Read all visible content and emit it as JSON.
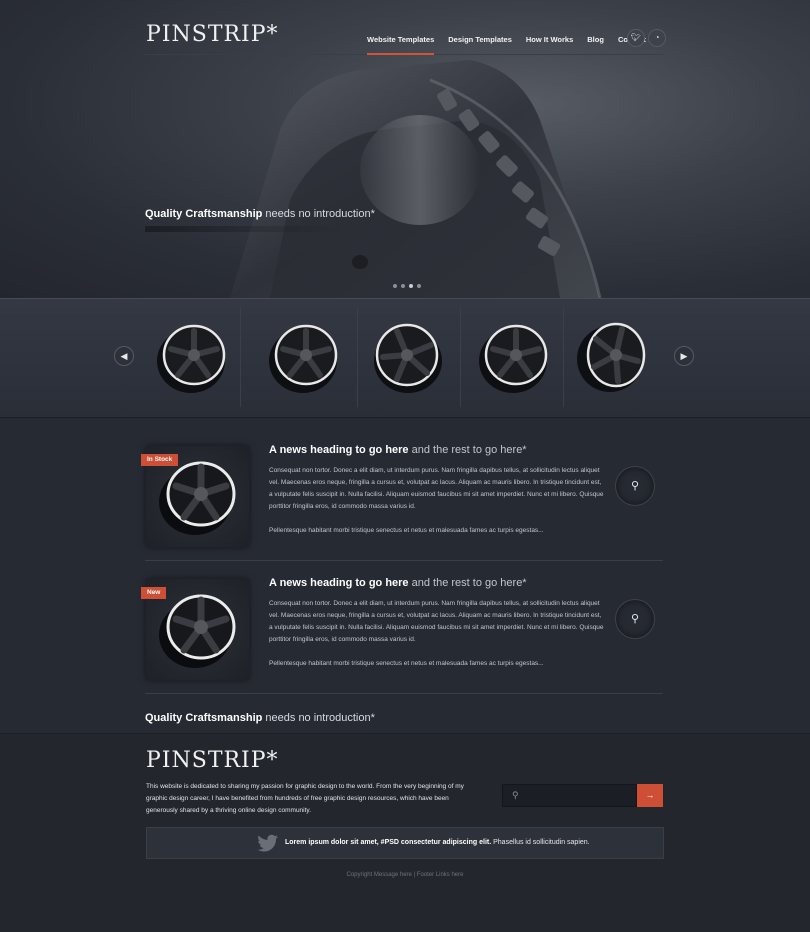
{
  "brand": {
    "logo": "PINSTRIP*"
  },
  "nav": {
    "items": [
      {
        "label": "Website Templates",
        "active": true
      },
      {
        "label": "Design Templates",
        "active": false
      },
      {
        "label": "How It Works",
        "active": false
      },
      {
        "label": "Blog",
        "active": false
      },
      {
        "label": "Contact",
        "active": false
      }
    ]
  },
  "social": {
    "twitter_icon": "twitter-icon",
    "rss_icon": "rss-icon"
  },
  "hero": {
    "tagline_bold": "Quality Craftsmanship",
    "tagline_rest": " needs no introduction*",
    "slides": 4,
    "active_slide": 2
  },
  "carousel": {
    "prev_icon": "chevron-left-icon",
    "next_icon": "chevron-right-icon",
    "items": 5
  },
  "news": [
    {
      "badge": "In Stock",
      "heading_bold": "A news heading to go here",
      "heading_rest": " and the rest to go here*",
      "body": "Consequat non tortor. Donec a elit diam, ut interdum purus. Nam fringilla dapibus tellus, at sollicitudin lectus aliquet vel. Maecenas eros neque, fringilla a cursus et, volutpat ac lacus. Aliquam ac mauris libero. In tristique tincidunt est, a vulputate felis suscipit in. Nulla facilisi. Aliquam euismod faucibus mi sit amet imperdiet. Nunc et mi libero. Quisque porttitor fringilla eros, id commodo massa varius id.",
      "body2": "Pellentesque habitant morbi tristique senectus et netus et malesuada fames ac turpis egestas..."
    },
    {
      "badge": "New",
      "heading_bold": "A news heading to go here",
      "heading_rest": " and the rest to go here*",
      "body": "Consequat non tortor. Donec a elit diam, ut interdum purus. Nam fringilla dapibus tellus, at sollicitudin lectus aliquet vel. Maecenas eros neque, fringilla a cursus et, volutpat ac lacus. Aliquam ac mauris libero. In tristique tincidunt est, a vulputate felis suscipit in. Nulla facilisi. Aliquam euismod faucibus mi sit amet imperdiet. Nunc et mi libero. Quisque porttitor fringilla eros, id commodo massa varius id.",
      "body2": "Pellentesque habitant morbi tristique senectus et netus et malesuada fames ac turpis egestas..."
    }
  ],
  "quote": {
    "bold": "Quality Craftsmanship",
    "rest": " needs no introduction*"
  },
  "footer": {
    "logo": "PINSTRIP*",
    "about": "This website is dedicated to sharing my passion for graphic design to the world. From the very beginning of my graphic design career, I have benefited from hundreds of free graphic design resources, which have been generously shared by a thriving online design community.",
    "search_placeholder": "",
    "search_button": "→",
    "tweet_bold": "Lorem ipsum dolor sit amet, #PSD consectetur adipiscing elit.",
    "tweet_rest": " Phasellus id sollicitudin sapien.",
    "copyright": "Copyright Message here | Footer Links here"
  },
  "colors": {
    "accent": "#cf4f36",
    "background": "#262a33"
  }
}
